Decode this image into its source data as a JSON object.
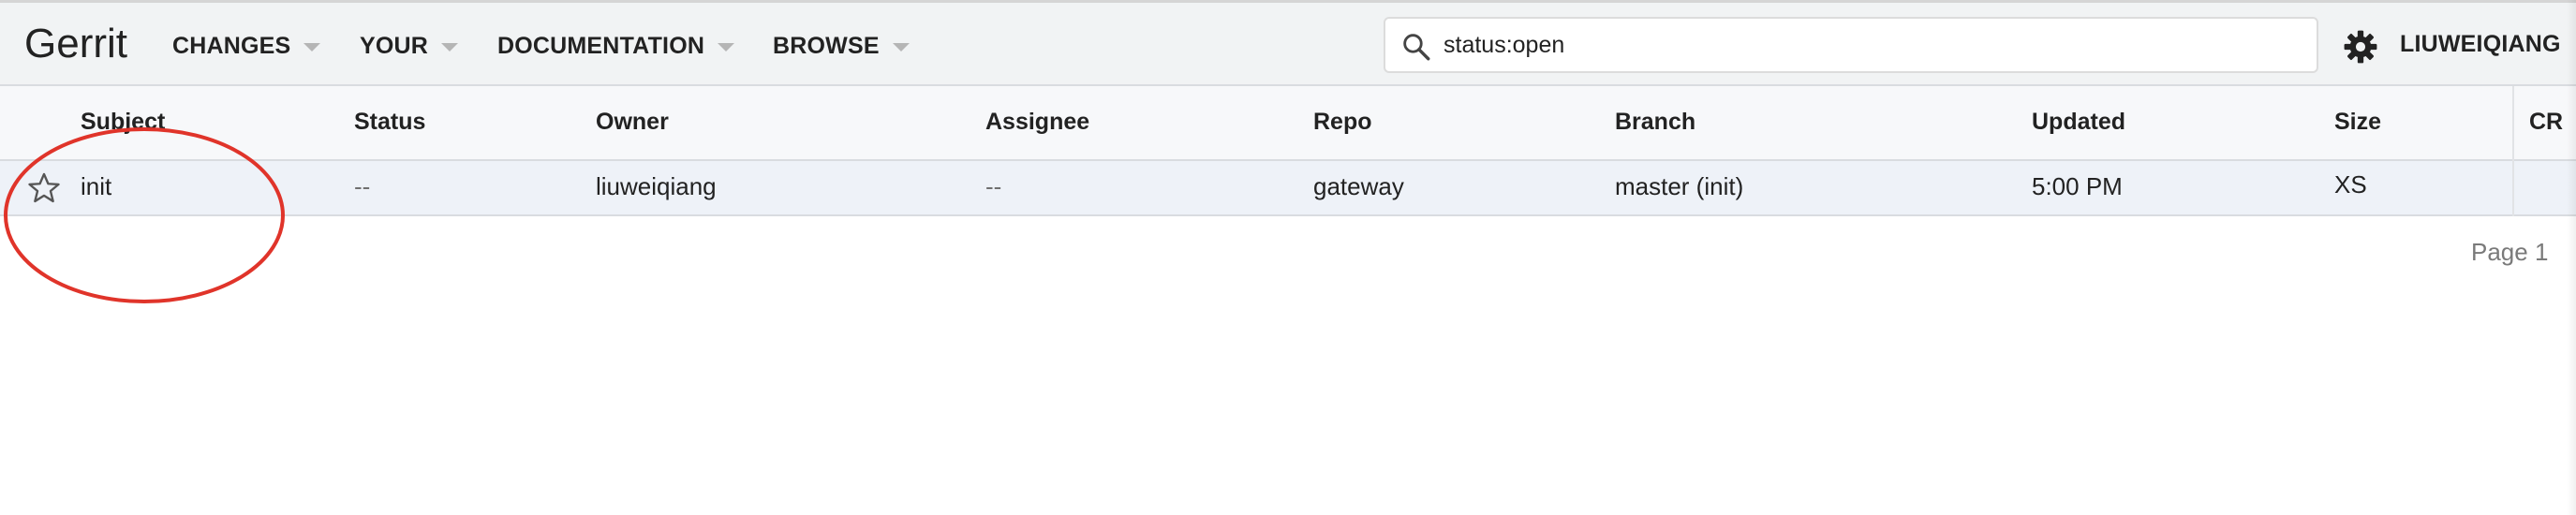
{
  "header": {
    "logo": "Gerrit",
    "nav": [
      {
        "label": "CHANGES"
      },
      {
        "label": "YOUR"
      },
      {
        "label": "DOCUMENTATION"
      },
      {
        "label": "BROWSE"
      }
    ],
    "search": {
      "value": "status:open",
      "icon": "search-icon"
    },
    "settings_icon": "gear-icon",
    "user": "LIUWEIQIANG"
  },
  "table": {
    "columns": [
      "Subject",
      "Status",
      "Owner",
      "Assignee",
      "Repo",
      "Branch",
      "Updated",
      "Size",
      "CR"
    ],
    "rows": [
      {
        "star_icon": "star-outline-icon",
        "subject": "init",
        "status": "--",
        "owner": "liuweiqiang",
        "assignee": "--",
        "repo": "gateway",
        "branch": "master (init)",
        "updated": "5:00 PM",
        "size": "XS",
        "cr": ""
      }
    ]
  },
  "pager": {
    "label": "Page 1"
  },
  "colors": {
    "header_bg": "#f1f3f4",
    "row_bg": "#eef2f8",
    "annotation": "#e0342a"
  }
}
